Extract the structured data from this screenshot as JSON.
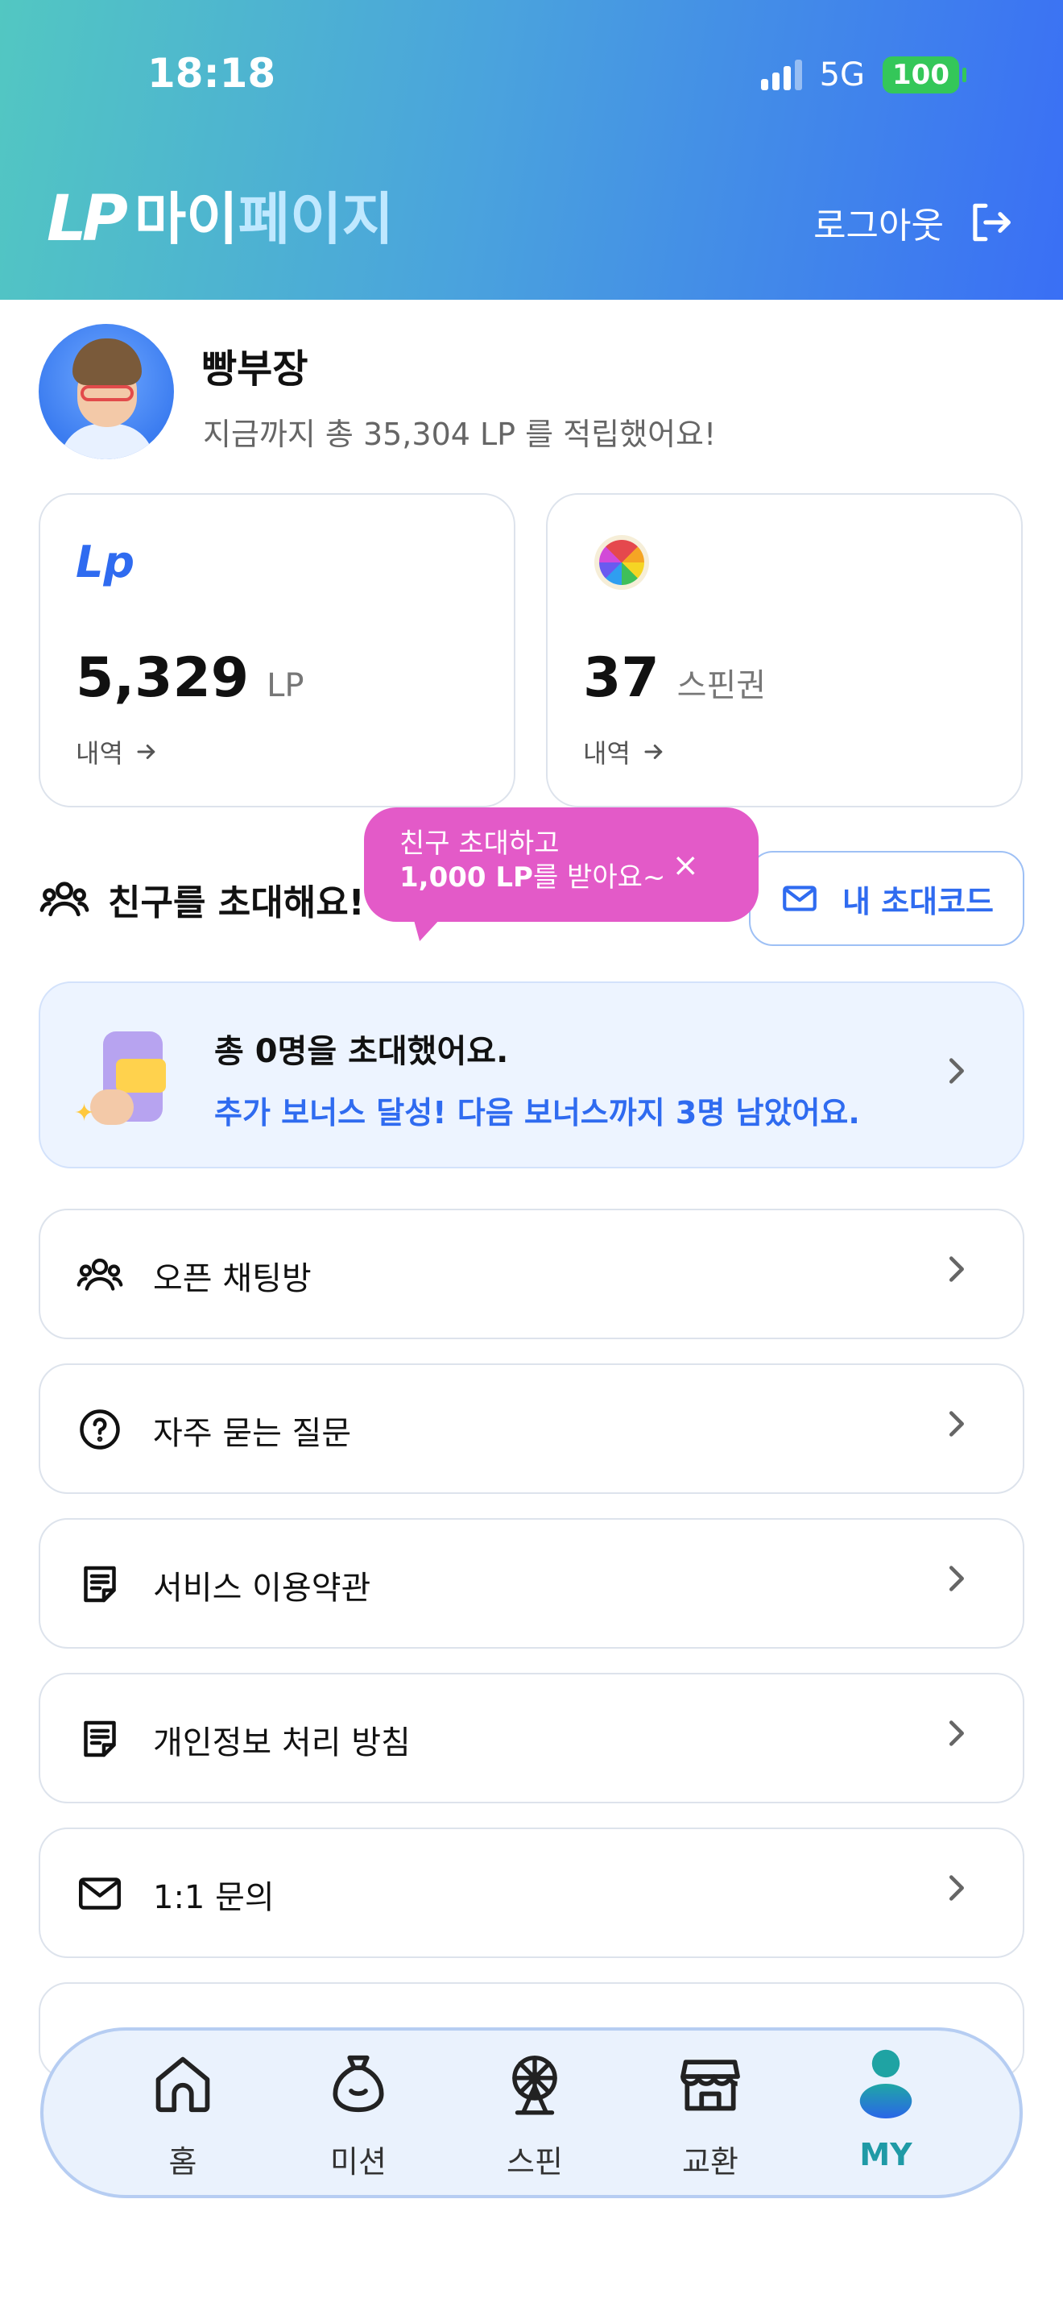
{
  "status_bar": {
    "time": "18:18",
    "network": "5G",
    "battery": "100"
  },
  "header": {
    "logo_text": "LP",
    "title_white": "마이",
    "title_light": "페이지",
    "logout_label": "로그아웃"
  },
  "profile": {
    "name": "빵부장",
    "summary": "지금까지 총 35,304 LP 를 적립했어요!"
  },
  "cards": {
    "lp": {
      "icon_text": "Lp",
      "value": "5,329",
      "unit": "LP",
      "history_label": "내역"
    },
    "spin": {
      "value": "37",
      "unit": "스핀권",
      "history_label": "내역"
    }
  },
  "invite": {
    "title": "친구를 초대해요!",
    "tooltip_line1": "친구 초대하고",
    "tooltip_line2_bold": "1,000 LP",
    "tooltip_line2_rest": "를 받아요~",
    "my_code_label": "내 초대코드",
    "banner_line1": "총 0명을 초대했어요.",
    "banner_line2": "추가 보너스 달성! 다음 보너스까지 3명 남았어요."
  },
  "menu": [
    {
      "label": "오픈 채팅방",
      "icon": "people-icon"
    },
    {
      "label": "자주 묻는 질문",
      "icon": "question-circle-icon"
    },
    {
      "label": "서비스 이용약관",
      "icon": "document-icon"
    },
    {
      "label": "개인정보 처리 방침",
      "icon": "document-icon"
    },
    {
      "label": "1:1 문의",
      "icon": "mail-icon"
    }
  ],
  "bottom_nav": [
    {
      "label": "홈",
      "icon": "home-icon",
      "active": false
    },
    {
      "label": "미션",
      "icon": "money-bag-icon",
      "active": false
    },
    {
      "label": "스핀",
      "icon": "ferris-wheel-icon",
      "active": false
    },
    {
      "label": "교환",
      "icon": "store-icon",
      "active": false
    },
    {
      "label": "MY",
      "icon": "user-icon",
      "active": true
    }
  ],
  "colors": {
    "accent_blue": "#2f6bf0",
    "tooltip_pink": "#e35ac8",
    "active_teal": "#1f9aa6"
  }
}
